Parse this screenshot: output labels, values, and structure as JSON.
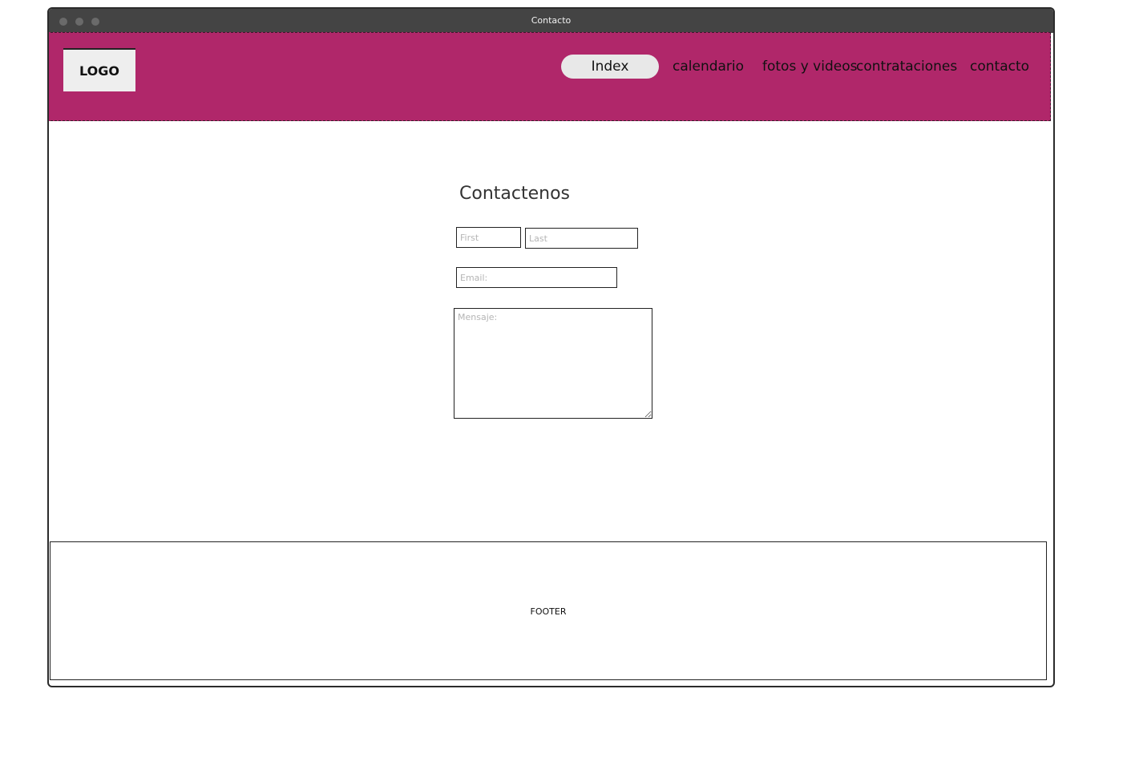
{
  "window": {
    "title": "Contacto"
  },
  "header": {
    "background_color": "#b0276a",
    "logo_text": "LOGO",
    "nav": [
      {
        "label": "Index",
        "active": true
      },
      {
        "label": "calendario",
        "active": false
      },
      {
        "label": "fotos y videos",
        "active": false
      },
      {
        "label": "contrataciones",
        "active": false
      },
      {
        "label": "contacto",
        "active": false
      }
    ]
  },
  "main": {
    "heading": "Contactenos",
    "form": {
      "first_placeholder": "First",
      "last_placeholder": "Last",
      "email_placeholder": "Email:",
      "message_placeholder": "Mensaje:"
    }
  },
  "footer": {
    "label": "FOOTER"
  }
}
